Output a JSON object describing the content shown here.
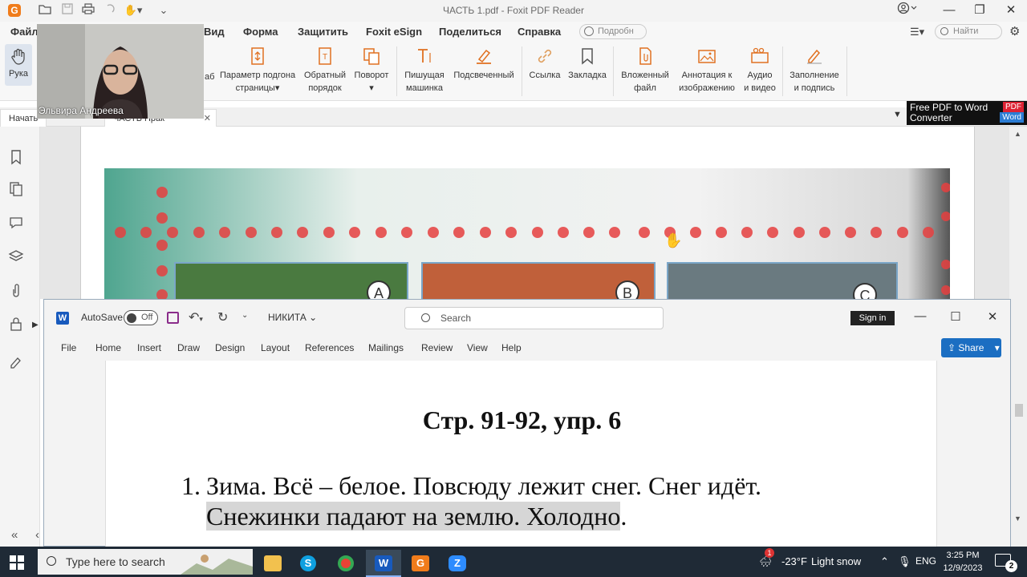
{
  "foxit": {
    "window_title": "ЧАСТЬ 1.pdf - Foxit PDF Reader",
    "menus": [
      "Файл",
      "Вид",
      "Форма",
      "Защитить",
      "Foxit eSign",
      "Поделиться",
      "Справка"
    ],
    "help_placeholder": "Подробн",
    "find_placeholder": "Найти",
    "hand_tool_label": "Рука",
    "ribbon_partial": "аб",
    "ribbon": {
      "fit_page": [
        "Параметр подгона",
        "страницы"
      ],
      "reverse_order": [
        "Обратный",
        "порядок"
      ],
      "rotate": "Поворот",
      "typewriter": [
        "Пишущая",
        "машинка"
      ],
      "highlight": "Подсвеченный",
      "link": "Ссылка",
      "bookmark": "Закладка",
      "attached_file": [
        "Вложенный",
        "файл"
      ],
      "image_annotation": [
        "Аннотация к",
        "изображению"
      ],
      "audio_video": [
        "Аудио",
        "и видео"
      ],
      "fill_sign": [
        "Заполнение",
        "и подпись"
      ]
    },
    "tabs": {
      "start": "Начать",
      "doc_partial": "ЧАСТЬ Прак"
    },
    "ad": {
      "line1": "Free PDF to Word",
      "line2": "Converter",
      "pdf": "PDF",
      "word": "Word"
    },
    "pdf_image": {
      "labels": [
        "A",
        "B",
        "C"
      ]
    }
  },
  "webcam": {
    "name": "Эльвира Андреева"
  },
  "word": {
    "autosave_label": "AutoSave",
    "autosave_state": "Off",
    "doc_name": "НИКИТА",
    "search_placeholder": "Search",
    "sign_in": "Sign in",
    "tabs": [
      "File",
      "Home",
      "Insert",
      "Draw",
      "Design",
      "Layout",
      "References",
      "Mailings",
      "Review",
      "View",
      "Help"
    ],
    "share_label": "Share",
    "content": {
      "heading": "Стр. 91-92, упр. 6",
      "item_number": "1.",
      "line1": "Зима. Всё – белое. Повсюду лежит снег. Снег идёт.",
      "line2_highlighted": "Снежинки падают на землю. Холодно",
      "line2_end": "."
    }
  },
  "taskbar": {
    "search_placeholder": "Type here to search",
    "weather_temp": "-23°F",
    "weather_desc": "Light snow",
    "language": "ENG",
    "time": "3:25 PM",
    "date": "12/9/2023",
    "notification_count": "2",
    "weather_badge": "1"
  },
  "colors": {
    "foxit_accent": "#f07c1b",
    "word_blue": "#1b6ec2",
    "taskbar_bg": "#1f2a36",
    "highlight_gray": "#d6d6d6"
  }
}
